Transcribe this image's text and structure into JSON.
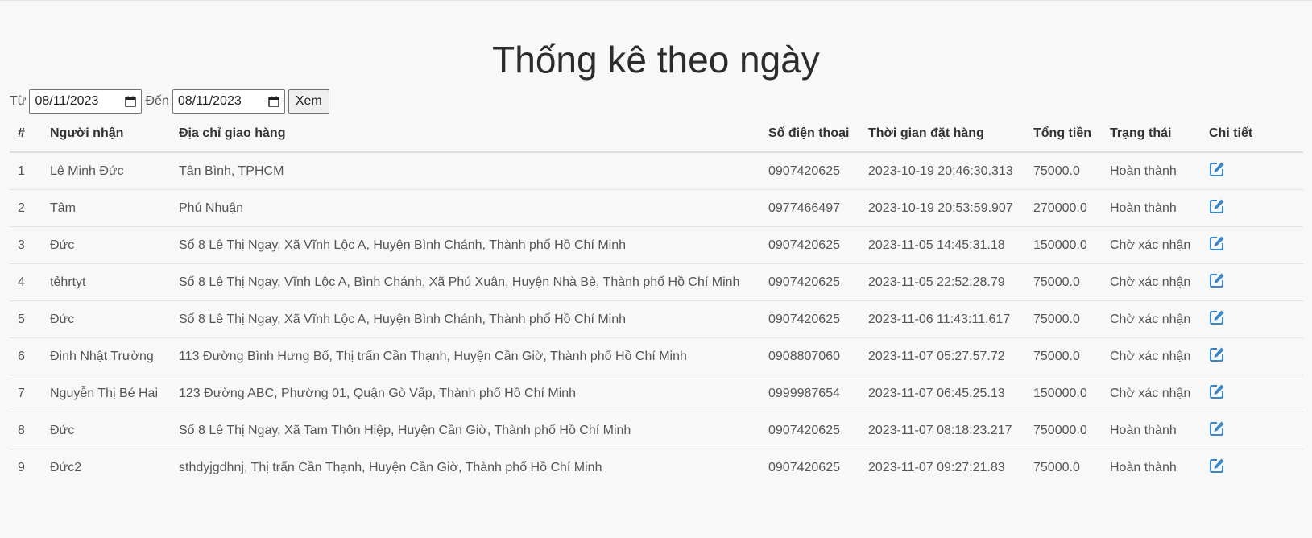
{
  "title": "Thống kê theo ngày",
  "filter": {
    "from_label": "Từ",
    "from_value": "08/11/2023",
    "to_label": "Đến",
    "to_value": "08/11/2023",
    "submit_label": "Xem"
  },
  "table": {
    "headers": [
      "#",
      "Người nhận",
      "Địa chỉ giao hàng",
      "Số điện thoại",
      "Thời gian đặt hàng",
      "Tổng tiền",
      "Trạng thái",
      "Chi tiết"
    ],
    "rows": [
      {
        "no": "1",
        "name": "Lê Minh Đức",
        "address": "Tân Bình, TPHCM",
        "phone": "0907420625",
        "time": "2023-10-19 20:46:30.313",
        "total": "75000.0",
        "status": "Hoàn thành"
      },
      {
        "no": "2",
        "name": "Tâm",
        "address": "Phú Nhuận",
        "phone": "0977466497",
        "time": "2023-10-19 20:53:59.907",
        "total": "270000.0",
        "status": "Hoàn thành"
      },
      {
        "no": "3",
        "name": "Đức",
        "address": "Số 8 Lê Thị Ngay, Xã Vĩnh Lộc A, Huyện Bình Chánh, Thành phố Hồ Chí Minh",
        "phone": "0907420625",
        "time": "2023-11-05 14:45:31.18",
        "total": "150000.0",
        "status": "Chờ xác nhận"
      },
      {
        "no": "4",
        "name": "tẻhrtyt",
        "address": "Số 8 Lê Thị Ngay, Vĩnh Lộc A, Bình Chánh, Xã Phú Xuân, Huyện Nhà Bè, Thành phố Hồ Chí Minh",
        "phone": "0907420625",
        "time": "2023-11-05 22:52:28.79",
        "total": "75000.0",
        "status": "Chờ xác nhận"
      },
      {
        "no": "5",
        "name": "Đức",
        "address": "Số 8 Lê Thị Ngay, Xã Vĩnh Lộc A, Huyện Bình Chánh, Thành phố Hồ Chí Minh",
        "phone": "0907420625",
        "time": "2023-11-06 11:43:11.617",
        "total": "75000.0",
        "status": "Chờ xác nhận"
      },
      {
        "no": "6",
        "name": "Đinh Nhật Trường",
        "address": "113 Đường Bình Hưng Bố, Thị trấn Cần Thạnh, Huyện Cần Giờ, Thành phố Hồ Chí Minh",
        "phone": "0908807060",
        "time": "2023-11-07 05:27:57.72",
        "total": "75000.0",
        "status": "Chờ xác nhận"
      },
      {
        "no": "7",
        "name": "Nguyễn Thị Bé Hai",
        "address": "123 Đường ABC, Phường 01, Quận Gò Vấp, Thành phố Hồ Chí Minh",
        "phone": "0999987654",
        "time": "2023-11-07 06:45:25.13",
        "total": "150000.0",
        "status": "Chờ xác nhận"
      },
      {
        "no": "8",
        "name": "Đức",
        "address": "Số 8 Lê Thị Ngay, Xã Tam Thôn Hiệp, Huyện Cần Giờ, Thành phố Hồ Chí Minh",
        "phone": "0907420625",
        "time": "2023-11-07 08:18:23.217",
        "total": "750000.0",
        "status": "Hoàn thành"
      },
      {
        "no": "9",
        "name": "Đức2",
        "address": "sthdyjgdhnj, Thị trấn Cần Thạnh, Huyện Cần Giờ, Thành phố Hồ Chí Minh",
        "phone": "0907420625",
        "time": "2023-11-07 09:27:21.83",
        "total": "75000.0",
        "status": "Hoàn thành"
      }
    ]
  },
  "colors": {
    "edit_icon": "#3a86c8"
  },
  "icons": {
    "detail": "edit-icon",
    "date_picker": "calendar-icon"
  }
}
